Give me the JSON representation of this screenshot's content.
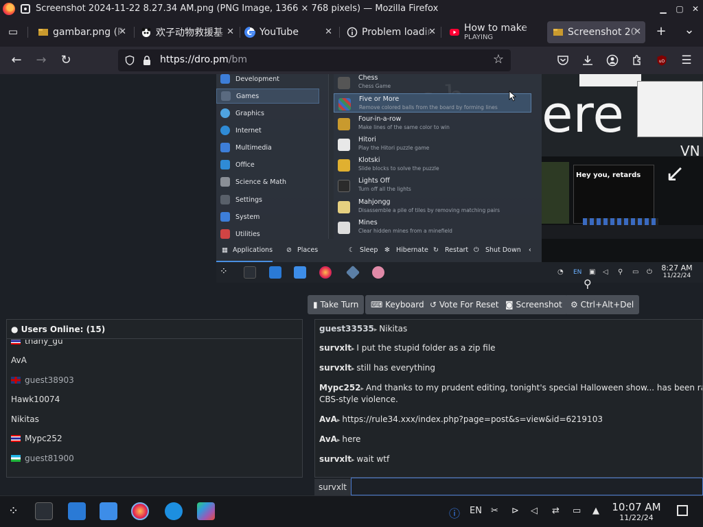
{
  "window": {
    "title": "Screenshot 2024-11-22 8.27.34 AM.png (PNG Image, 1366 × 768 pixels) — Mozilla Firefox",
    "min": "▁",
    "max": "▢",
    "close": "✕"
  },
  "tabs": [
    {
      "title": "gambar.png (P",
      "close": "✕"
    },
    {
      "title": "欢子动物救援基",
      "close": "✕"
    },
    {
      "title": "YouTube",
      "close": "✕"
    },
    {
      "title": "Problem loadin",
      "close": "✕"
    },
    {
      "title": "How to make",
      "sub": "PLAYING",
      "close": "✕"
    },
    {
      "title": "Screenshot 20",
      "close": "✕"
    }
  ],
  "tabbar": {
    "new_tab": "+",
    "list_all": "⌄"
  },
  "nav": {
    "back": "←",
    "forward": "→",
    "reload": "↻",
    "url_host": "https://dro.pm",
    "url_path": "/bm",
    "bookmark": "☆"
  },
  "remote_menu": {
    "categories": [
      {
        "label": "Development",
        "color": "#3d7ed8"
      },
      {
        "label": "Games",
        "color": "#5a6a80"
      },
      {
        "label": "Graphics",
        "color": "#4fa3e0"
      },
      {
        "label": "Internet",
        "color": "#2f8bd6"
      },
      {
        "label": "Multimedia",
        "color": "#3d7ed8"
      },
      {
        "label": "Office",
        "color": "#2f8bd6"
      },
      {
        "label": "Science & Math",
        "color": "#8a8f96"
      },
      {
        "label": "Settings",
        "color": "#59606a"
      },
      {
        "label": "System",
        "color": "#3d7ed8"
      },
      {
        "label": "Utilities",
        "color": "#d04444"
      }
    ],
    "apps": [
      {
        "name": "Chess",
        "desc": "Chess Game",
        "color": "#555"
      },
      {
        "name": "Five or More",
        "desc": "Remove colored balls from the board by forming lines",
        "color": "#3a8c5a"
      },
      {
        "name": "Four-in-a-row",
        "desc": "Make lines of the same color to win",
        "color": "#c99a2e"
      },
      {
        "name": "Hitori",
        "desc": "Play the Hitori puzzle game",
        "color": "#e8e8e8"
      },
      {
        "name": "Klotski",
        "desc": "Slide blocks to solve the puzzle",
        "color": "#e0b030"
      },
      {
        "name": "Lights Off",
        "desc": "Turn off all the lights",
        "color": "#2b2b2b"
      },
      {
        "name": "Mahjongg",
        "desc": "Disassemble a pile of tiles by removing matching pairs",
        "color": "#e6d080"
      },
      {
        "name": "Mines",
        "desc": "Clear hidden mines from a minefield",
        "color": "#ddd"
      }
    ],
    "footer": {
      "applications": "Applications",
      "places": "Places",
      "sleep": "Sleep",
      "hibernate": "Hibernate",
      "restart": "Restart",
      "shutdown": "Shut Down"
    },
    "overlay_text": "ere",
    "meme_text": "Hey you, retards",
    "remote_clock_time": "8:27 AM",
    "remote_clock_date": "11/22/24",
    "remote_lang": "EN"
  },
  "controls": {
    "take_turn": "Take Turn",
    "keyboard": "Keyboard",
    "vote_reset": "Vote For Reset",
    "screenshot": "Screenshot",
    "ctrl_alt_del": "Ctrl+Alt+Del"
  },
  "users": {
    "header": "Users Online: (15)",
    "list": [
      {
        "name": "thany_gu",
        "flag": "th",
        "guest": false
      },
      {
        "name": "AvA",
        "flag": "",
        "guest": false
      },
      {
        "name": "guest38903",
        "flag": "uk",
        "guest": true
      },
      {
        "name": "Hawk10074",
        "flag": "",
        "guest": false
      },
      {
        "name": "Nikitas",
        "flag": "",
        "guest": false
      },
      {
        "name": "Mypc252",
        "flag": "th",
        "guest": false
      },
      {
        "name": "guest81900",
        "flag": "uz",
        "guest": true
      }
    ]
  },
  "chat": {
    "messages": [
      {
        "user": "guest33535",
        "text": "Nikitas"
      },
      {
        "user": "survxlt",
        "text": "I put the stupid folder as a zip file"
      },
      {
        "user": "survxlt",
        "text": "still has everything"
      },
      {
        "user": "Mypc252",
        "text": "And thanks to my prudent editing, tonight's special Halloween show... has been rated TV \"G.\" This m",
        "text2": "CBS-style violence."
      },
      {
        "user": "AvA",
        "text": "https://rule34.xxx/index.php?page=post&s=view&id=6219103"
      },
      {
        "user": "AvA",
        "text": "here"
      },
      {
        "user": "survxlt",
        "text": "wait wtf"
      }
    ],
    "name_label": "survxlt",
    "input_value": ""
  },
  "taskbar": {
    "lang": "EN",
    "clock_time": "10:07 AM",
    "clock_date": "11/22/24"
  }
}
